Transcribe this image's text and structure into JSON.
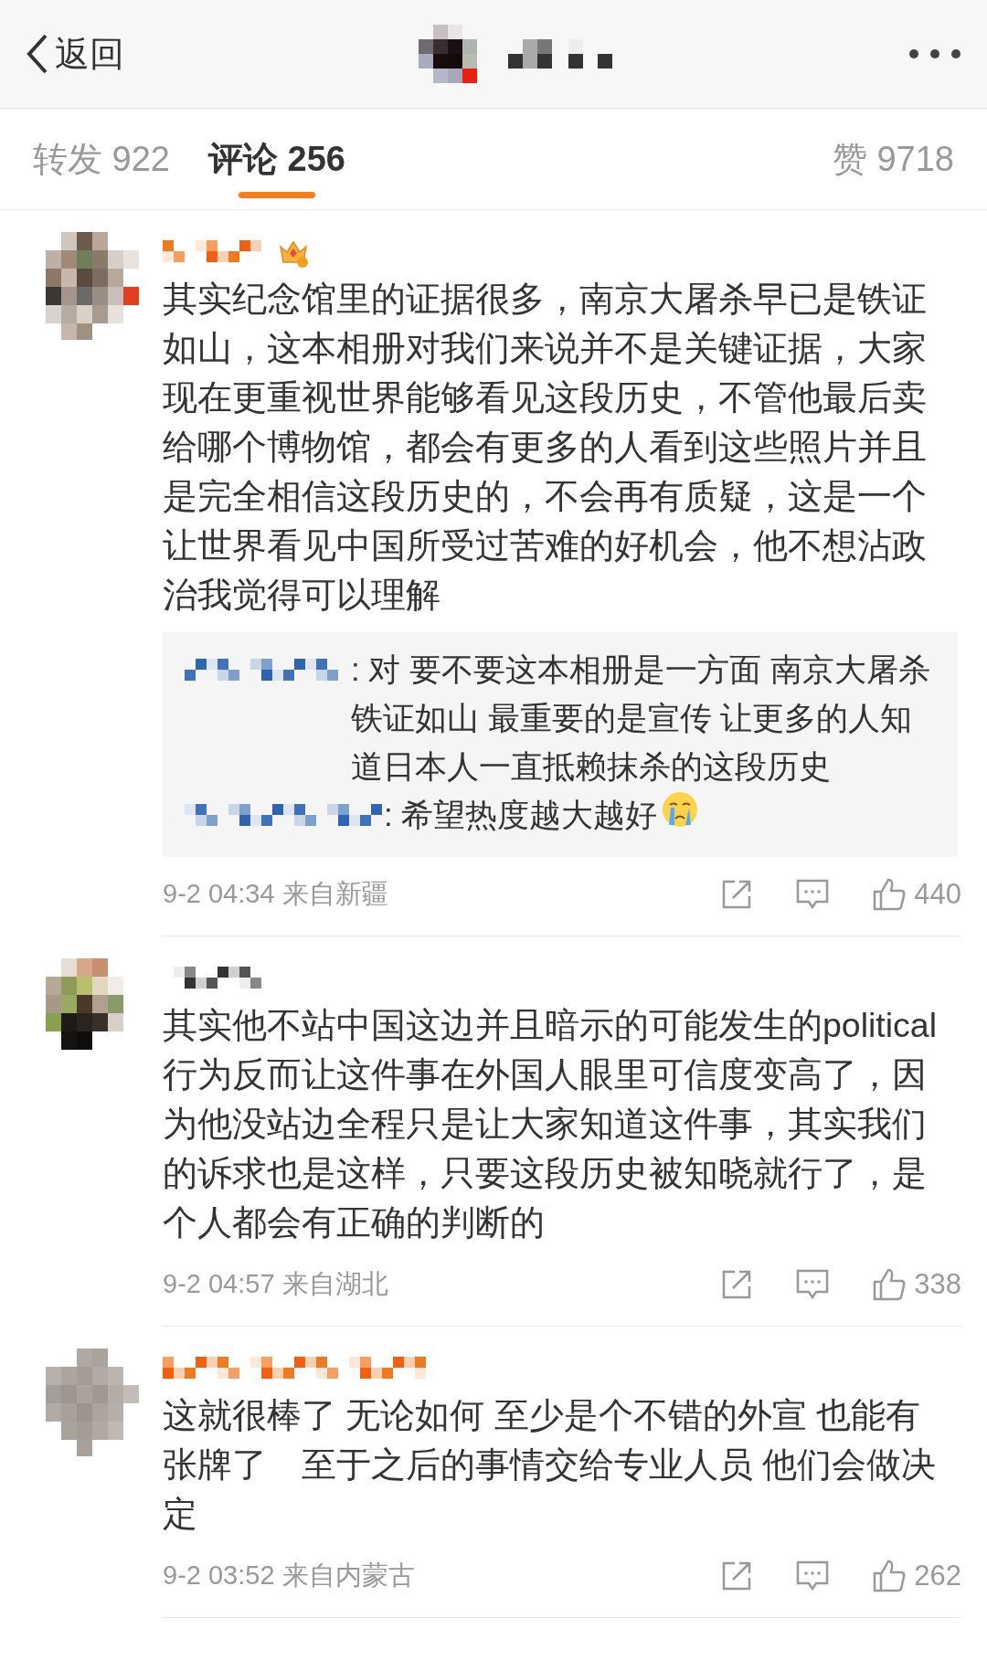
{
  "header": {
    "back_label": "返回"
  },
  "tabs": [
    {
      "label": "转发 922",
      "selected": false
    },
    {
      "label": "评论 256",
      "selected": true
    },
    {
      "label": "赞 9718",
      "selected": false
    }
  ],
  "comments": [
    {
      "vip": true,
      "badge": true,
      "text": "其实纪念馆里的证据很多，南京大屠杀早已是铁证如山，这本相册对我们来说并不是关键证据，大家现在更重视世界能够看见这段历史，不管他最后卖给哪个博物馆，都会有更多的人看到这些照片并且是完全相信这段历史的，不会再有质疑，这是一个让世界看见中国所受过苦难的好机会，他不想沾政治我觉得可以理解",
      "replies": [
        {
          "text": ": 对 要不要这本相册是一方面 南京大屠杀铁证如山 最重要的是宣传 让更多的人知道日本人一直抵赖抹杀的这段历史",
          "emoji": false
        },
        {
          "text": ": 希望热度越大越好",
          "emoji": true
        }
      ],
      "time": "9-2 04:34",
      "location": "来自新疆",
      "likes": "440"
    },
    {
      "vip": false,
      "badge": false,
      "text": "其实他不站中国这边并且暗示的可能发生的political 行为反而让这件事在外国人眼里可信度变高了，因为他没站边全程只是让大家知道这件事，其实我们的诉求也是这样，只要这段历史被知晓就行了，是个人都会有正确的判断的",
      "time": "9-2 04:57",
      "location": "来自湖北",
      "likes": "338"
    },
    {
      "vip": true,
      "badge": false,
      "text": "这就很棒了 无论如何 至少是个不错的外宣 也能有张牌了　至于之后的事情交给专业人员 他们会做决定",
      "time": "9-2 03:52",
      "location": "来自内蒙古",
      "likes": "262"
    }
  ]
}
